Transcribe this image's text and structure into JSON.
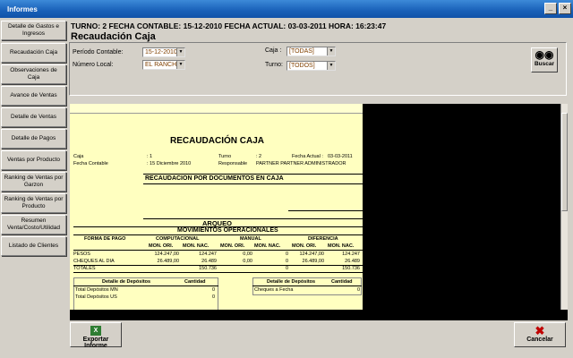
{
  "window": {
    "title": "Informes"
  },
  "sidebar": {
    "items": [
      {
        "label": "Detalle de Gastos e Ingresos"
      },
      {
        "label": "Recaudación Caja"
      },
      {
        "label": "Observaciones de Caja"
      },
      {
        "label": "Avance de Ventas"
      },
      {
        "label": "Detalle de Ventas"
      },
      {
        "label": "Detalle de Pagos"
      },
      {
        "label": "Ventas por Producto"
      },
      {
        "label": "Ranking de Ventas por Garzon"
      },
      {
        "label": "Ranking de Ventas por Producto"
      },
      {
        "label": "Resumen Venta/Costo/Utilidad"
      },
      {
        "label": "Listado de Clientes"
      }
    ]
  },
  "header": {
    "status": "TURNO: 2  FECHA CONTABLE: 15-12-2010  FECHA ACTUAL: 03-03-2011  HORA: 16:23:47",
    "title": "Recaudación Caja"
  },
  "filters": {
    "periodo_label": "Período Contable:",
    "periodo_value": "15-12-2010",
    "local_label": "Número Local:",
    "local_value": "EL RANCHE",
    "caja_label": "Caja :",
    "caja_value": "[TODAS]",
    "turno_label": "Turno:",
    "turno_value": "[TODOS]",
    "buscar_label": "Buscar"
  },
  "report": {
    "title": "RECAUDACIÓN CAJA",
    "caja_label": "Caja",
    "caja_value": ": 1",
    "fecha_contable_label": "Fecha Contable",
    "fecha_contable_value": ": 15 Diciembre 2010",
    "turno_label": "Turno",
    "turno_value": ": 2",
    "responsable_label": "Responsable",
    "responsable_value": "PARTNER PARTNER ADMINISTRADOR",
    "fecha_actual_label": "Fecha Actual :",
    "fecha_actual_value": "03-03-2011",
    "section_docs": "RECAUDACION POR DOCUMENTOS EN CAJA",
    "section_arqueo": "ARQUEO",
    "section_movs": "MOVIMIENTOS OPERACIONALES",
    "col_forma": "FORMA DE PAGO",
    "col_computacional": "COMPUTACIONAL",
    "col_manual": "MANUAL",
    "col_diferencia": "DIFERENCIA",
    "sub_mon_ori": "MON. ORI.",
    "sub_mon_nac": "MON. NAC.",
    "rows": [
      {
        "forma": "PESOS",
        "comp_ori": "124.247,00",
        "comp_nac": "124.247",
        "man_ori": "0,00",
        "man_nac": "0",
        "dif_ori": "124.247,00",
        "dif_nac": "124.247"
      },
      {
        "forma": "CHEQUES AL DIA",
        "comp_ori": "26.489,00",
        "comp_nac": "26.489",
        "man_ori": "0,00",
        "man_nac": "0",
        "dif_ori": "26.489,00",
        "dif_nac": "26.489"
      }
    ],
    "totales_label": "TOTALES",
    "totales_comp": "150.736",
    "totales_man": "0",
    "totales_dif": "150.736",
    "dep_title": "Detalle de Depósitos",
    "dep_cantidad": "Cantidad",
    "dep_rows": [
      {
        "label": "Total Depósitos MN",
        "value": "0"
      },
      {
        "label": "Total Depósitos US",
        "value": "0"
      }
    ],
    "dep2_title": "Detalle de Depósitos",
    "dep2_cantidad": "Cantidad",
    "dep2_rows": [
      {
        "label": "Cheques a Fecha",
        "value": "0"
      }
    ]
  },
  "footer": {
    "export_label": "Exportar Informe",
    "cancel_label": "Cancelar"
  },
  "colors": {
    "titlebar": "#1960b8",
    "report_bg": "#ffffc0",
    "accent_text": "#804000"
  }
}
